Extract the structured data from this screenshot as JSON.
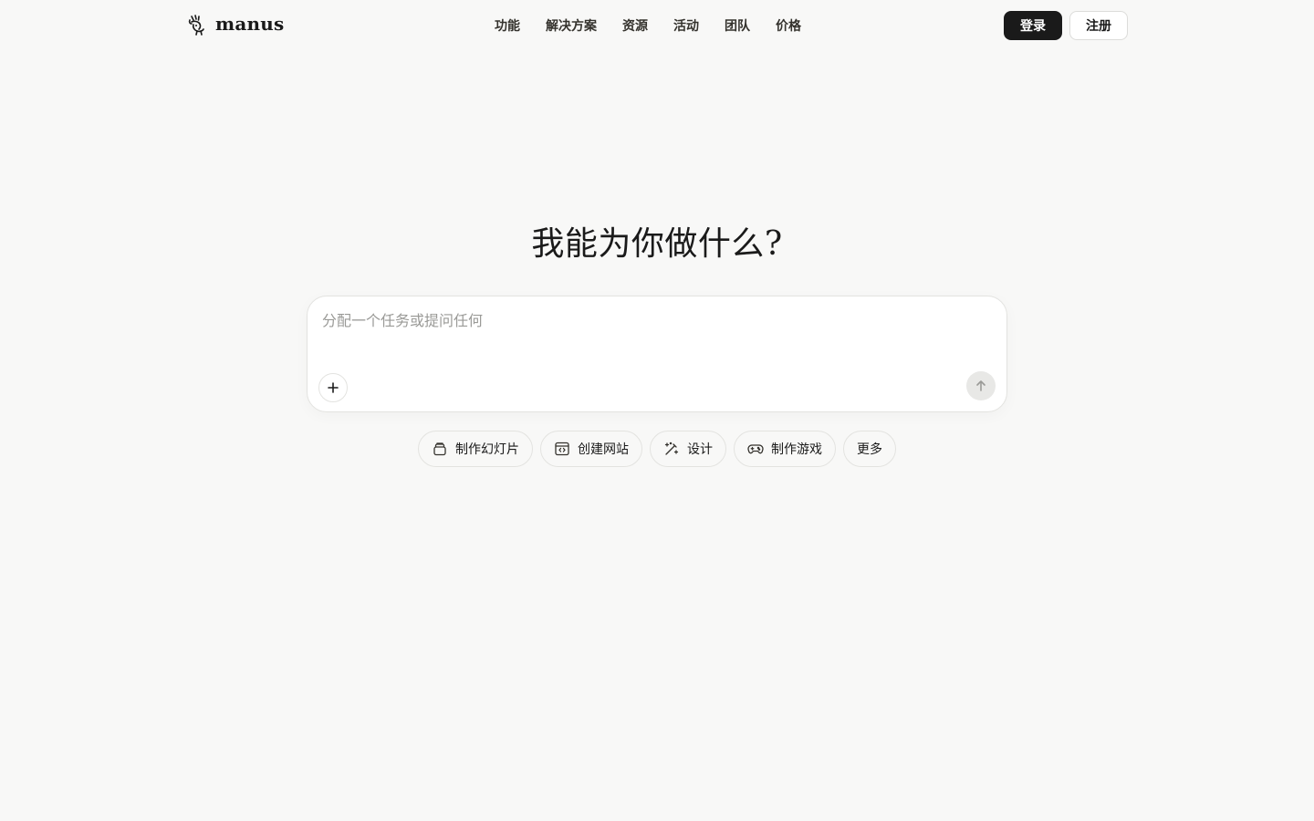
{
  "brand": {
    "name": "manus",
    "logo_icon": "manus-hand-icon"
  },
  "nav": {
    "items": [
      {
        "label": "功能"
      },
      {
        "label": "解决方案"
      },
      {
        "label": "资源"
      },
      {
        "label": "活动"
      },
      {
        "label": "团队"
      },
      {
        "label": "价格"
      }
    ]
  },
  "auth": {
    "login_label": "登录",
    "signup_label": "注册"
  },
  "hero": {
    "title": "我能为你做什么?"
  },
  "composer": {
    "placeholder": "分配一个任务或提问任何",
    "value": "",
    "attach_icon": "plus-icon",
    "send_icon": "arrow-up-icon"
  },
  "chips": [
    {
      "label": "制作幻灯片",
      "icon": "slides-icon"
    },
    {
      "label": "创建网站",
      "icon": "code-window-icon"
    },
    {
      "label": "设计",
      "icon": "magic-wand-icon"
    },
    {
      "label": "制作游戏",
      "icon": "gamepad-icon"
    },
    {
      "label": "更多",
      "icon": ""
    }
  ],
  "colors": {
    "background": "#f8f8f7",
    "primary": "#1a1a1a",
    "border": "#e3e3e0",
    "placeholder": "#9a9a97"
  }
}
